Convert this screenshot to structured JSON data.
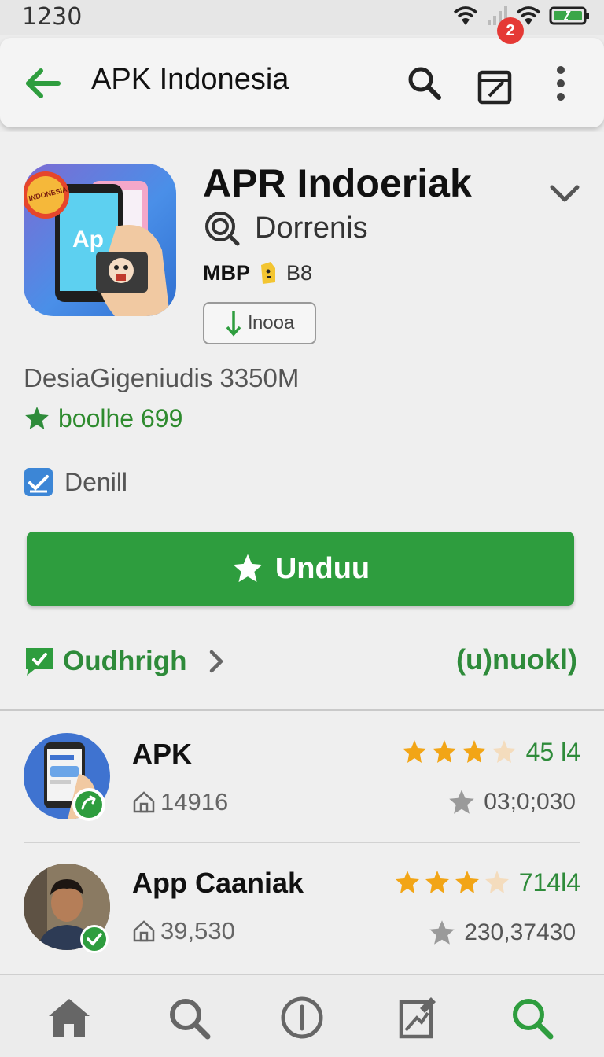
{
  "status_bar": {
    "time": "1230"
  },
  "app_bar": {
    "title": "APK Indonesia",
    "notification_count": "2"
  },
  "app_detail": {
    "title": "APR Indoeriak",
    "developer": "Dorrenis",
    "meta_left": "MBP",
    "meta_right": "B8",
    "small_button_label": "lnooa",
    "icon_text": "Ap",
    "icon_sticker_text": "INDONESIA",
    "description": "DesiaGigeniudis 3350M",
    "rating_text": "boolhe 699",
    "check_label": "Denill",
    "download_button": "Unduu",
    "link_left": "Oudhrigh",
    "link_right": "(u)nuokl)"
  },
  "list": [
    {
      "name": "APK",
      "sub_value": "14916",
      "rating_label": "45 l4",
      "stars": 3.5,
      "count": "03;0;030"
    },
    {
      "name": "App Caaniak",
      "sub_value": "39,530",
      "rating_label": "714l4",
      "stars": 3.5,
      "count": "230,37430"
    }
  ],
  "colors": {
    "accent_green": "#2e9d3e",
    "text_green": "#2e8b3a",
    "badge_red": "#e53935",
    "star_gold": "#f2a516"
  },
  "icons": {
    "status": [
      "wifi-icon",
      "signal-icon",
      "wifi-icon",
      "battery-icon"
    ],
    "app_bar": [
      "back-arrow-icon",
      "search-icon",
      "edit-icon",
      "more-vert-icon"
    ],
    "bottom_nav": [
      "home-icon",
      "search-icon",
      "info-icon",
      "edit-icon",
      "search-icon"
    ]
  }
}
